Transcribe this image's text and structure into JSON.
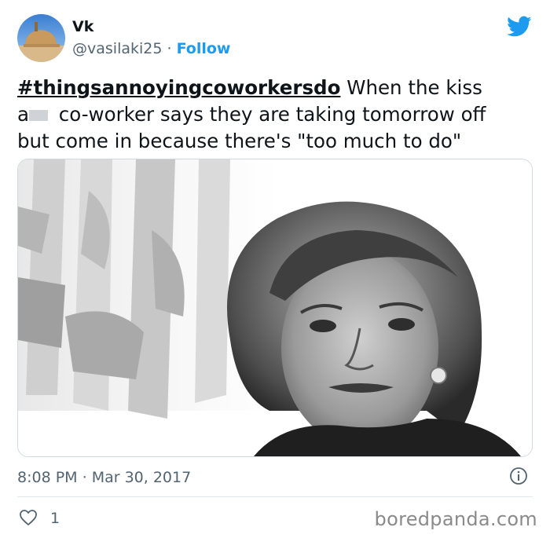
{
  "tweet": {
    "display_name": "Vk",
    "handle": "@vasilaki25",
    "separator": "·",
    "follow_label": "Follow",
    "hashtag": "#thingsannoyingcoworkersdo",
    "text_part1": " When the kiss",
    "text_line2_prefix": "a",
    "text_line2_rest": " co-worker says they are taking tomorrow off",
    "text_line3": "but come in because there's \"too much to do\"",
    "time": "8:08 PM",
    "date": "Mar 30, 2017",
    "like_count": "1"
  },
  "watermark": "boredpanda.com",
  "icons": {
    "platform": "twitter-bird-icon",
    "info": "info-icon",
    "like": "heart-icon"
  },
  "colors": {
    "link_blue": "#1d9bf0",
    "muted": "#536471",
    "text": "#0f1419"
  }
}
